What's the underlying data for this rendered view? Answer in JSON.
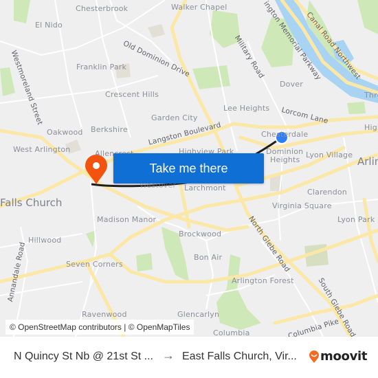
{
  "map": {
    "colors": {
      "background": "#efeff0",
      "road_major": "#fbe8a6",
      "road_minor": "#ffffff",
      "park": "#cfe8b8",
      "water": "#a9d3f3",
      "route_line": "#1e1e1e",
      "origin_marker": "#2f7ef5",
      "destination_marker": "#f2530f"
    },
    "place_labels": [
      "Chesterbrook",
      "El Nido",
      "Walker Chapel",
      "Franklin Park",
      "Crescent Hills",
      "Garden City",
      "Lee Heights",
      "Dover",
      "Oakwood",
      "Berkshire",
      "West Arlington",
      "Allencrest",
      "Highview Park",
      "Chesterdale",
      "Dominion Heights",
      "Lyon Village",
      "Larchmont",
      "Westover",
      "Falls Church",
      "Madison Manor",
      "Clarendon",
      "Virginia Square",
      "Lyon Park",
      "Hillwood",
      "Brockwood",
      "Seven Corners",
      "Bon Air",
      "Arlington Forest",
      "Ravenwood",
      "Glencarlyn",
      "Columbia",
      "Arlington",
      "Three Sisters Island",
      "Highlands"
    ],
    "road_labels": [
      "Old Dominion Drive",
      "Military Road",
      "Arlington Memorial Parkway",
      "Canal Road Northwest",
      "Westmoreland Street",
      "Lorcom Lane",
      "Langston Boulevard",
      "North Glebe Road",
      "South Glebe Road",
      "Annandale Road",
      "Columbia Pike"
    ],
    "labels": {
      "chesterbrook": "Chesterbrook",
      "el_nido": "El Nido",
      "walker_chapel": "Walker Chapel",
      "franklin_park": "Franklin Park",
      "crescent_hills": "Crescent Hills",
      "garden_city": "Garden City",
      "lee_heights": "Lee Heights",
      "dover": "Dover",
      "oakwood": "Oakwood",
      "berkshire": "Berkshire",
      "west_arlington": "West Arlington",
      "allencrest": "Allencrest",
      "highview_park": "Highview Park",
      "chesterdale": "Chesterdale",
      "dominion": "Dominion",
      "heights": "Heights",
      "lyon_village": "Lyon Village",
      "larchmont": "Larchmont",
      "westover": "Westover",
      "falls_church": "Falls Church",
      "madison_manor": "Madison Manor",
      "clarendon": "Clarendon",
      "virginia_square": "Virginia Square",
      "lyon_park": "Lyon Park",
      "hillwood": "Hillwood",
      "brockwood": "Brockwood",
      "seven_corners": "Seven Corners",
      "bon_air": "Bon Air",
      "arlington_forest": "Arlington Forest",
      "ravenwood": "Ravenwood",
      "glencarlyn": "Glencarlyn",
      "columbia": "Columbia",
      "arlington": "Arlin",
      "three": "Thre",
      "high": "High",
      "old_dominion_drive": "Old Dominion Drive",
      "military_road": "Military Road",
      "memorial_parkway": "ington Memorial Parkway",
      "canal_road": "Canal Road Northwest",
      "westmoreland": "Westmoreland Street",
      "lorcom_lane": "Lorcom Lane",
      "langston": "Langston Boulevard",
      "north_glebe": "North Glebe Road",
      "south_glebe": "South Glebe Road",
      "annandale": "Annandale Road",
      "columbia_pike": "Columbia Pike"
    }
  },
  "cta": {
    "label": "Take me there"
  },
  "attribution": "© OpenStreetMap contributors | © OpenMapTiles",
  "footer": {
    "origin": "N Quincy St Nb @ 21st St ...",
    "arrow_icon": "→",
    "destination": "East Falls Church, Vir...",
    "brand": "moovit",
    "brand_color": "#f26b21"
  }
}
